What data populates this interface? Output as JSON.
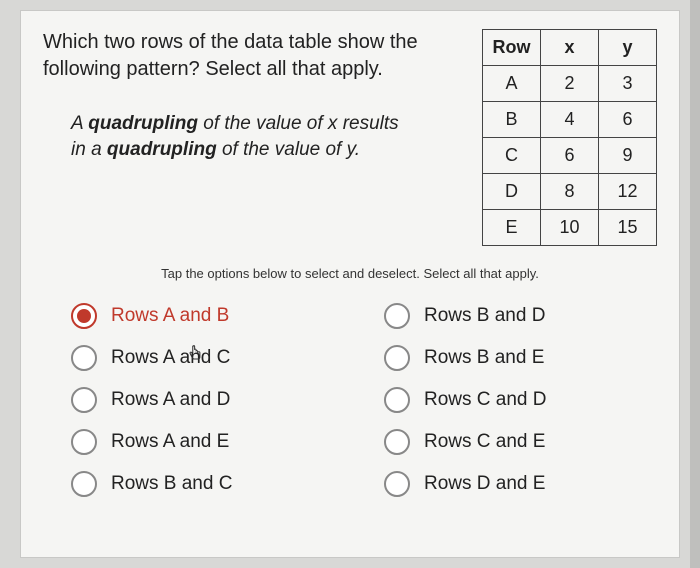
{
  "question": {
    "prompt": "Which two rows of the data table show the following pattern? Select all that apply.",
    "pattern_html": "A <span class='bi'>quadrupling</span> of the value of x results in a <span class='bi'>quadrupling</span> of the value of y."
  },
  "table": {
    "headers": [
      "Row",
      "x",
      "y"
    ],
    "rows": [
      {
        "row": "A",
        "x": 2,
        "y": 3
      },
      {
        "row": "B",
        "x": 4,
        "y": 6
      },
      {
        "row": "C",
        "x": 6,
        "y": 9
      },
      {
        "row": "D",
        "x": 8,
        "y": 12
      },
      {
        "row": "E",
        "x": 10,
        "y": 15
      }
    ]
  },
  "hint": "Tap the options below to select and deselect. Select all that apply.",
  "options": {
    "col1": [
      {
        "label": "Rows A and B",
        "selected": true
      },
      {
        "label": "Rows A and C",
        "selected": false
      },
      {
        "label": "Rows A and D",
        "selected": false
      },
      {
        "label": "Rows A and E",
        "selected": false
      },
      {
        "label": "Rows B and C",
        "selected": false
      }
    ],
    "col2": [
      {
        "label": "Rows B and D",
        "selected": false
      },
      {
        "label": "Rows B and E",
        "selected": false
      },
      {
        "label": "Rows C and D",
        "selected": false
      },
      {
        "label": "Rows C and E",
        "selected": false
      },
      {
        "label": "Rows D and E",
        "selected": false
      }
    ]
  },
  "chart_data": {
    "type": "table",
    "columns": [
      "Row",
      "x",
      "y"
    ],
    "data": [
      [
        "A",
        2,
        3
      ],
      [
        "B",
        4,
        6
      ],
      [
        "C",
        6,
        9
      ],
      [
        "D",
        8,
        12
      ],
      [
        "E",
        10,
        15
      ]
    ]
  }
}
